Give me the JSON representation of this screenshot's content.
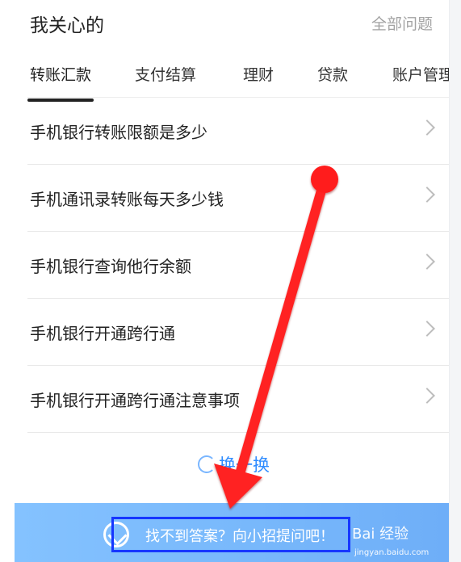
{
  "header": {
    "title": "我关心的",
    "all_questions": "全部问题"
  },
  "tabs": [
    {
      "label": "转账汇款",
      "active": true
    },
    {
      "label": "支付结算",
      "active": false
    },
    {
      "label": "理财",
      "active": false
    },
    {
      "label": "贷款",
      "active": false
    },
    {
      "label": "账户管理",
      "active": false
    }
  ],
  "list": [
    {
      "label": "手机银行转账限额是多少"
    },
    {
      "label": "手机通讯录转账每天多少钱"
    },
    {
      "label": "手机银行查询他行余额"
    },
    {
      "label": "手机银行开通跨行通"
    },
    {
      "label": "手机银行开通跨行通注意事项"
    }
  ],
  "refresh": {
    "label": "换一换"
  },
  "banner": {
    "text": "找不到答案？向小招提问吧！",
    "watermark": "Bai 经验",
    "watermark_sub": "jingyan.baidu.com"
  },
  "colors": {
    "accent": "#2f8cff",
    "banner": "#7fbfff",
    "highlight": "#1636ff",
    "annotation": "#ff2424"
  }
}
